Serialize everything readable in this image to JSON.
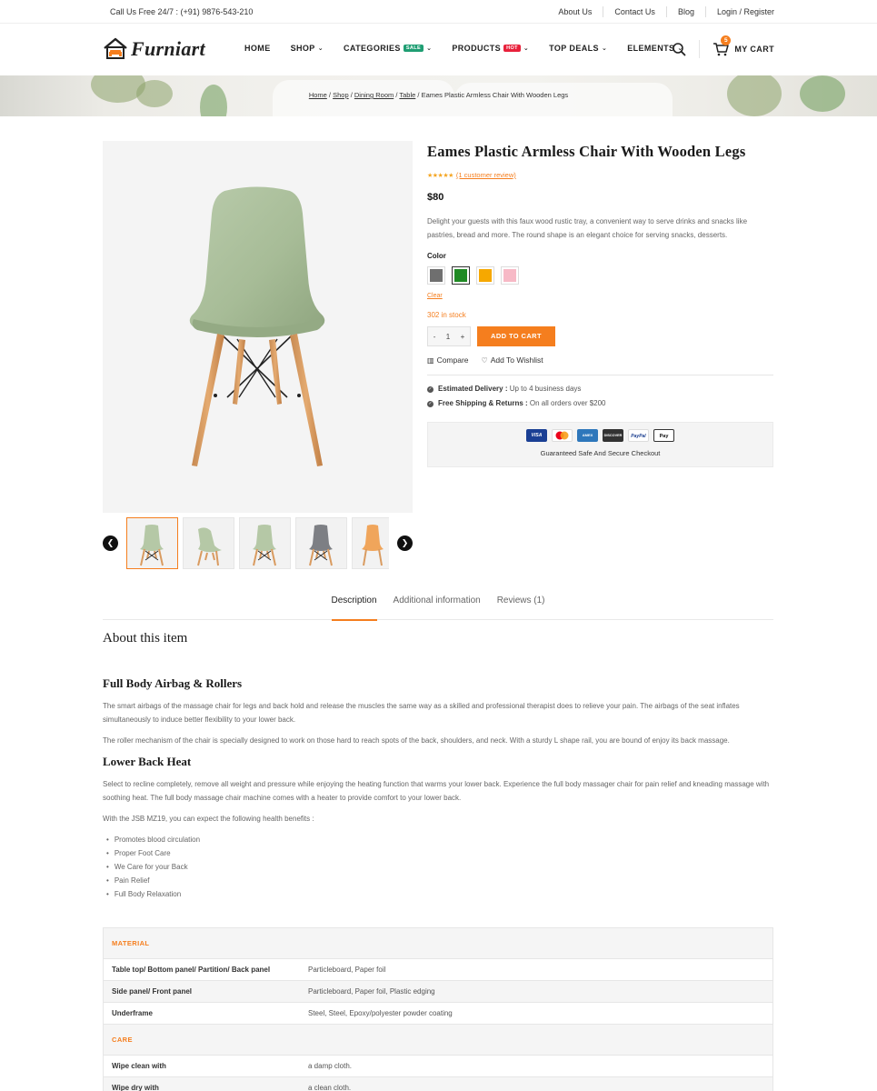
{
  "topbar": {
    "phone": "Call Us Free 24/7 : (+91) 9876-543-210",
    "links": [
      "About Us",
      "Contact Us",
      "Blog",
      "Login / Register"
    ]
  },
  "header": {
    "logo_text": "Furniart",
    "nav": [
      {
        "label": "HOME"
      },
      {
        "label": "SHOP"
      },
      {
        "label": "CATEGORIES",
        "badge": "SALE"
      },
      {
        "label": "PRODUCTS",
        "badge": "HOT"
      },
      {
        "label": "TOP DEALS"
      },
      {
        "label": "ELEMENTS"
      }
    ],
    "cart_count": "5",
    "cart_label": "MY CART"
  },
  "breadcrumb": {
    "items": [
      "Home",
      "Shop",
      "Dining Room",
      "Table"
    ],
    "current": "Eames Plastic Armless Chair With Wooden Legs"
  },
  "product": {
    "title": "Eames Plastic Armless Chair With Wooden Legs",
    "stars": "★★★★★",
    "review_link": "(1 customer review)",
    "price": "$80",
    "description": "Delight your guests with this faux wood rustic tray, a convenient way to serve drinks and snacks like pastries, bread and more. The round shape is an elegant choice for serving snacks, desserts.",
    "color_label": "Color",
    "colors": [
      "#6f6f6f",
      "#1f8a24",
      "#f6a800",
      "#f7b9c6"
    ],
    "selected_color_index": 1,
    "clear": "Clear",
    "stock": "302 in stock",
    "qty_minus": "-",
    "qty": "1",
    "qty_plus": "+",
    "add_to_cart": "ADD TO CART",
    "compare": "Compare",
    "wishlist": "Add To Wishlist",
    "delivery_label": "Estimated Delivery :",
    "delivery_value": "Up to 4 business days",
    "shipping_label": "Free Shipping & Returns :",
    "shipping_value": "On all orders over $200",
    "payment_cards": [
      "VISA",
      "MC",
      "AMEX",
      "DISCOVER",
      "PayPal",
      "Pay"
    ],
    "secure_text": "Guaranteed Safe And Secure Checkout",
    "thumb_colors": [
      "#b5c8a6",
      "#b5c8a6",
      "#b5c8a6",
      "#7d7f84",
      "#f0a55b"
    ]
  },
  "tabs": [
    "Description",
    "Additional information",
    "Reviews (1)"
  ],
  "description": {
    "about": "About this item",
    "h1": "Full Body Airbag & Rollers",
    "p1": "The smart airbags of the massage chair for legs and back hold and release the muscles the same way as a skilled and professional therapist does to relieve your pain. The airbags of the seat inflates simultaneously to induce better flexibility to your lower back.",
    "p2": "The roller mechanism of the chair is specially designed to work on those hard to reach spots of the back, shoulders, and neck. With a sturdy L shape rail, you are bound of enjoy its back massage.",
    "h2": "Lower Back Heat",
    "p3": "Select to recline completely, remove all weight and pressure while enjoying the heating function that warms your lower back. Experience the full body massager chair for pain relief and kneading massage with soothing heat. The full body massage chair machine comes with a heater to provide comfort to your lower back.",
    "p4": "With the JSB MZ19, you can expect the following health benefits :",
    "benefits": [
      "Promotes blood circulation",
      "Proper Foot Care",
      "We Care for your Back",
      "Pain Relief",
      "Full Body Relaxation"
    ]
  },
  "spec": {
    "material_head": "MATERIAL",
    "material": [
      {
        "k": "Table top/ Bottom panel/ Partition/ Back panel",
        "v": "Particleboard, Paper foil"
      },
      {
        "k": "Side panel/ Front panel",
        "v": "Particleboard, Paper foil, Plastic edging"
      },
      {
        "k": "Underframe",
        "v": " Steel, Steel, Epoxy/polyester powder coating"
      }
    ],
    "care_head": "CARE",
    "care": [
      {
        "k": "Wipe clean with",
        "v": "a damp cloth."
      },
      {
        "k": "Wipe dry with",
        "v": "a clean cloth."
      }
    ]
  },
  "colors": {
    "accent": "#f57e1e",
    "text": "#222222"
  }
}
